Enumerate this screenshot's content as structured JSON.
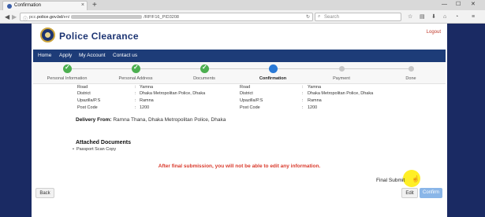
{
  "browser": {
    "tab_title": "Confirmation",
    "tab_close": "×",
    "new_tab": "+",
    "url_prefix": "pcc.",
    "url_domain": "police.gov.bd",
    "url_path_start": "/en/",
    "url_path_end": "/RP/F16_PID3208",
    "search_placeholder": "Search",
    "win_minimize": "—",
    "win_maximize": "☐",
    "win_close": "✕"
  },
  "site": {
    "title": "Police Clearance",
    "logout": "Logout"
  },
  "menu": {
    "items": [
      "Home",
      "Apply",
      "My Account",
      "Contact us"
    ]
  },
  "steps": [
    {
      "label": "Personal Information",
      "state": "done"
    },
    {
      "label": "Personal Address",
      "state": "done"
    },
    {
      "label": "Documents",
      "state": "done"
    },
    {
      "label": "Confirmation",
      "state": "active"
    },
    {
      "label": "Payment",
      "state": "todo"
    },
    {
      "label": "Done",
      "state": "todo"
    }
  ],
  "address_left": [
    {
      "k": "Road",
      "c": ":",
      "v": "Yamna"
    },
    {
      "k": "District",
      "c": ":",
      "v": "Dhaka Metropolitan Police, Dhaka"
    },
    {
      "k": "Upazilla/P.S",
      "c": ":",
      "v": "Ramna"
    },
    {
      "k": "Post Code",
      "c": ":",
      "v": "1200"
    }
  ],
  "address_right": [
    {
      "k": "Road",
      "c": ":",
      "v": "Yamna"
    },
    {
      "k": "District",
      "c": ":",
      "v": "Dhaka Metropolitan Police, Dhaka"
    },
    {
      "k": "Upazilla/P.S",
      "c": ":",
      "v": "Ramna"
    },
    {
      "k": "Post Code",
      "c": ":",
      "v": "1200"
    }
  ],
  "delivery": {
    "label": "Delivery From:",
    "value": "Ramna Thana, Dhaka Metropolitan Police, Dhaka"
  },
  "attachments": {
    "title": "Attached Documents",
    "items": [
      "Passport Scan Copy"
    ]
  },
  "warning": "After final submission, you will not be able to edit any information.",
  "final_submit_label": "Final Submit",
  "buttons": {
    "back": "Back",
    "edit": "Edit",
    "confirm": "Confirm"
  },
  "colors": {
    "brand": "#1c3472",
    "menu_bg": "#1d3c78",
    "step_done": "#4caf50",
    "step_active": "#2979d6",
    "warning": "#d9392b",
    "confirm_btn": "#8ab6e8"
  }
}
